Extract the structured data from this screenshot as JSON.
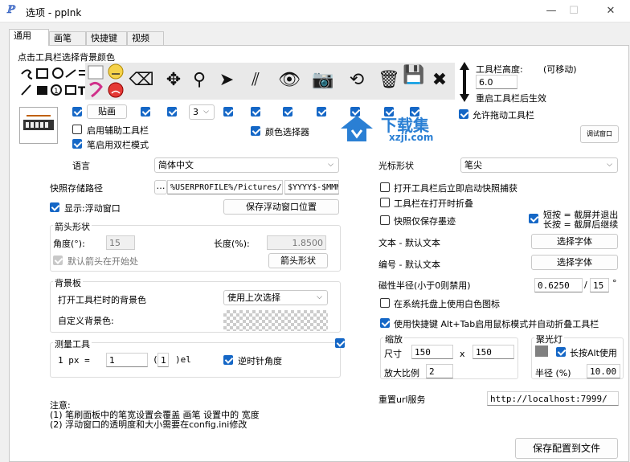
{
  "window": {
    "title": "选项 - ppInk",
    "icon": "ℙ",
    "minimize": "—",
    "maximize": "☐",
    "close": "✕"
  },
  "tabs": [
    "通用",
    "画笔",
    "快捷键",
    "视频"
  ],
  "toolbar_bg": {
    "label": "点击工具栏选择背景颜色"
  },
  "toolbar_icons": {
    "pencil": "✏",
    "eraser": "⌫",
    "move": "✥",
    "magnet": "⚲",
    "cursor": "➤",
    "lines": "⫽",
    "eye": "👁",
    "camera": "📷",
    "undo": "⟲",
    "trash": "🗑",
    "save": "💾",
    "close": "✖"
  },
  "toolbar_height": {
    "label": "工具栏高度:",
    "movable": "(可移动)",
    "value": "6.0",
    "restart_note": "重启工具栏后生效"
  },
  "check_row": {
    "palette_label": "贴画",
    "count": "3"
  },
  "aux": {
    "enable_aux": "启用辅助工具栏",
    "dual_mode": "笔启用双栏模式",
    "color_picker": "颜色选择器",
    "allow_drag": "允许拖动工具栏",
    "debug_btn": "调试窗口"
  },
  "watermark": {
    "name": "下载集",
    "url": "xzji.com"
  },
  "language": {
    "label": "语言",
    "value": "简体中文"
  },
  "cursor": {
    "label": "光标形状",
    "value": "笔尖"
  },
  "snapshot": {
    "label": "快照存储路径",
    "browse": "…",
    "path": "%USERPROFILE%/Pictures/i",
    "pattern": "$YYYY$-$MMM"
  },
  "float": {
    "show": "显示:浮动窗口",
    "save_pos": "保存浮动窗口位置"
  },
  "arrow": {
    "title": "箭头形状",
    "angle_label": "角度(°):",
    "angle_value": "15",
    "length_label": "长度(%):",
    "length_value": "1.8500",
    "default_start": "默认箭头在开始处",
    "shape_btn": "箭头形状"
  },
  "background": {
    "title": "背景板",
    "open_label": "打开工具栏时的背景色",
    "open_value": "使用上次选择",
    "custom_label": "自定义背景色:"
  },
  "measure": {
    "title": "测量工具",
    "px_label": "1 px =",
    "value1": "1",
    "paren_open": "(",
    "value2": "1",
    "paren_close": ")el",
    "clockwise": "逆时针角度"
  },
  "right": {
    "open_snapshot": "打开工具栏后立即启动快照捕获",
    "fold_toolbar": "工具栏在打开时折叠",
    "snapshot_only": "快照仅保存墨迹",
    "short_press": "短按 = 截屏并退出",
    "long_press": "长按 = 截屏后继续",
    "text_label": "文本 - 默认文本",
    "text_btn": "选择字体",
    "number_label": "编号 - 默认文本",
    "number_btn": "选择字体",
    "magnet_label": "磁性半径(小于0则禁用)",
    "magnet_value": "0.6250",
    "magnet_sep": "/",
    "magnet_value2": "15",
    "magnet_unit": "°",
    "tray_white": "在系统托盘上使用白色图标",
    "alt_tab": "使用快捷键 Alt+Tab启用鼠标模式并自动折叠工具栏"
  },
  "zoom": {
    "title": "缩放",
    "size_label": "尺寸",
    "w": "150",
    "x": "x",
    "h": "150",
    "ratio_label": "放大比例",
    "ratio": "2"
  },
  "spotlight": {
    "title": "聚光灯",
    "hold_alt": "长按Alt使用",
    "radius_label": "半径 (%)",
    "radius": "10.00"
  },
  "reset": {
    "label": "重置url服务",
    "value": "http://localhost:7999/"
  },
  "note": {
    "title": "注意:",
    "line1": "(1) 笔刷面板中的笔宽设置会覆盖 画笔 设置中的 宽度",
    "line2": "(2) 浮动窗口的透明度和大小需要在config.ini修改"
  },
  "save": {
    "label": "保存配置到文件"
  },
  "colors": {
    "accent": "#1567c6",
    "watermark": "#2a7fd4"
  }
}
